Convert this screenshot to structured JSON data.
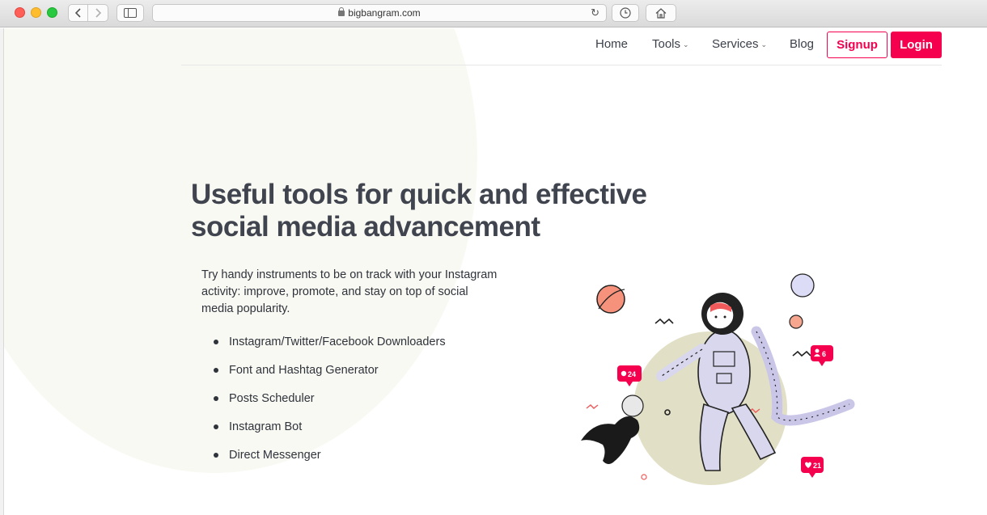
{
  "browser": {
    "url": "bigbangram.com"
  },
  "nav": {
    "home": "Home",
    "tools": "Tools",
    "services": "Services",
    "blog": "Blog",
    "signup": "Signup",
    "login": "Login"
  },
  "hero": {
    "title_line1": "Useful tools for quick and effective",
    "title_line2": "social media advancement",
    "description": "Try handy instruments to be on track with your Instagram activity: improve, promote, and stay on top of social media popularity.",
    "features": [
      "Instagram/Twitter/Facebook Downloaders",
      "Font and Hashtag Generator",
      "Posts Scheduler",
      "Instagram Bot",
      "Direct Messenger"
    ]
  },
  "illustration": {
    "badge_comments": "24",
    "badge_followers": "6",
    "badge_likes": "21"
  },
  "colors": {
    "brand": "#f5004f",
    "heading": "#40444e",
    "planet_green": "#e1e0c6"
  }
}
